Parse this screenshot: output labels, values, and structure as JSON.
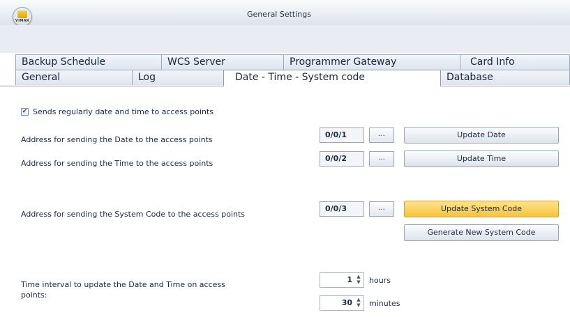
{
  "window": {
    "title": "General Settings",
    "logo_text": "VIMAR"
  },
  "tabs_row1": [
    "Backup Schedule",
    "WCS Server",
    "Programmer Gateway",
    "Card Info"
  ],
  "tabs_row2": [
    "General",
    "Log",
    "Date - Time - System code",
    "Database"
  ],
  "active_tab": "Date - Time - System code",
  "sends_regularly": {
    "label": "Sends regularly date and time to access points",
    "checked": true
  },
  "date_row": {
    "label": "Address for sending the Date to the access points",
    "address": "0/0/1",
    "browse": "...",
    "button": "Update Date"
  },
  "time_row": {
    "label": "Address for sending the Time to the access points",
    "address": "0/0/2",
    "browse": "...",
    "button": "Update Time"
  },
  "syscode_row": {
    "label": "Address for sending the System Code to the access points",
    "address": "0/0/3",
    "browse": "...",
    "button": "Update System Code",
    "generate_button": "Generate New System Code"
  },
  "interval": {
    "label_line1": "Time interval to update the Date and Time on access",
    "label_line2": "points:",
    "hours_value": "1",
    "hours_unit": "hours",
    "minutes_value": "30",
    "minutes_unit": "minutes"
  }
}
